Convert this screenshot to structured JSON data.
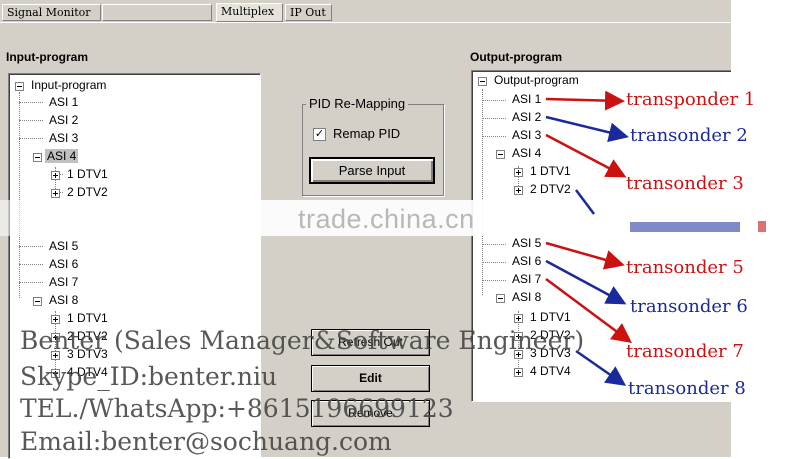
{
  "tabs": [
    {
      "label": "Signal Monitor",
      "active": false
    },
    {
      "label": "",
      "active": false
    },
    {
      "label": "Multiplex",
      "active": true
    },
    {
      "label": "IP Out",
      "active": false
    }
  ],
  "input": {
    "group_title": "Input-program",
    "root": "Input-program",
    "items": {
      "asi1": "ASI 1",
      "asi2": "ASI 2",
      "asi3": "ASI 3",
      "asi4": "ASI 4",
      "dtv1": "1 DTV1",
      "dtv2": "2 DTV2",
      "asi5": "ASI 5",
      "asi6": "ASI 6",
      "asi7": "ASI 7",
      "asi8": "ASI 8",
      "asi8_dtv1": "1 DTV1",
      "asi8_dtv2": "2 DTV2",
      "asi8_dtv3": "3 DTV3",
      "asi8_dtv4": "4 DTV4"
    },
    "selected": "ASI 4"
  },
  "output": {
    "group_title": "Output-program",
    "root": "Output-program",
    "items": {
      "asi1": "ASI 1",
      "asi2": "ASI 2",
      "asi3": "ASI 3",
      "asi4": "ASI 4",
      "dtv1": "1 DTV1",
      "dtv2": "2 DTV2",
      "asi5": "ASI 5",
      "asi6": "ASI 6",
      "asi7": "ASI 7",
      "asi8": "ASI 8",
      "asi8_dtv1": "1 DTV1",
      "asi8_dtv2": "2 DTV2",
      "asi8_dtv3": "3 DTV3",
      "asi8_dtv4": "4 DTV4"
    }
  },
  "pid": {
    "group_title": "PID Re-Mapping",
    "checkbox_label": "Remap PID",
    "checked": true,
    "check_glyph": "✓",
    "parse_button": "Parse Input"
  },
  "actions": {
    "refresh": "Refresh Out",
    "edit": "Edit",
    "remove": "Remove"
  },
  "watermark": "trade.china.cn",
  "overlay_lines": [
    "Benter (Sales Manager&Software Engineer)",
    "Skype_ID:benter.niu",
    "TEL./WhatsApp:+8615196699123",
    "Email:benter@sochuang.com"
  ],
  "annotations": {
    "t1": "transponder 1",
    "t2": "transonder 2",
    "t3": "transonder 3",
    "t5": "transonder 5",
    "t6": "transonder 6",
    "t7": "transonder 7",
    "t8": "transonder 8"
  },
  "colors": {
    "red_annotation": "#cc1111",
    "blue_annotation": "#1a2a9a",
    "window_bg": "#d4d0c8"
  }
}
